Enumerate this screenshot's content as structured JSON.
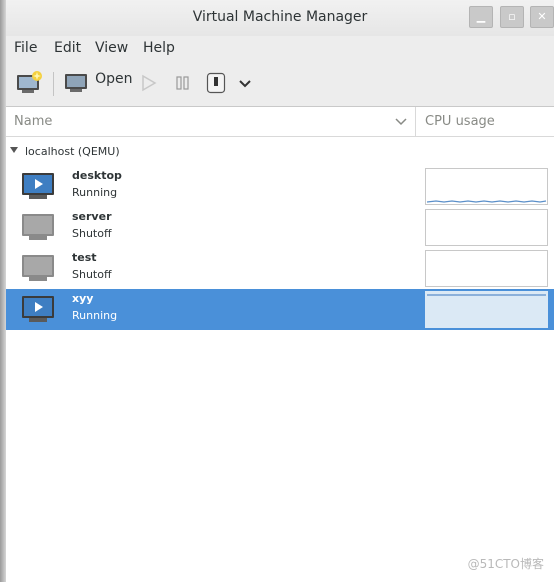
{
  "window": {
    "title": "Virtual Machine Manager"
  },
  "menu": {
    "file": "File",
    "edit": "Edit",
    "view": "View",
    "help": "Help"
  },
  "toolbar": {
    "open_label": "Open"
  },
  "table": {
    "col_name": "Name",
    "col_cpu": "CPU usage"
  },
  "connection": {
    "label": "localhost (QEMU)"
  },
  "vms": [
    {
      "name": "desktop",
      "status": "Running"
    },
    {
      "name": "server",
      "status": "Shutoff"
    },
    {
      "name": "test",
      "status": "Shutoff"
    },
    {
      "name": "xyy",
      "status": "Running"
    }
  ],
  "watermark": "@51CTO博客",
  "colors": {
    "selection": "#4a90d9",
    "cpu_line": "#5b8fc9"
  }
}
